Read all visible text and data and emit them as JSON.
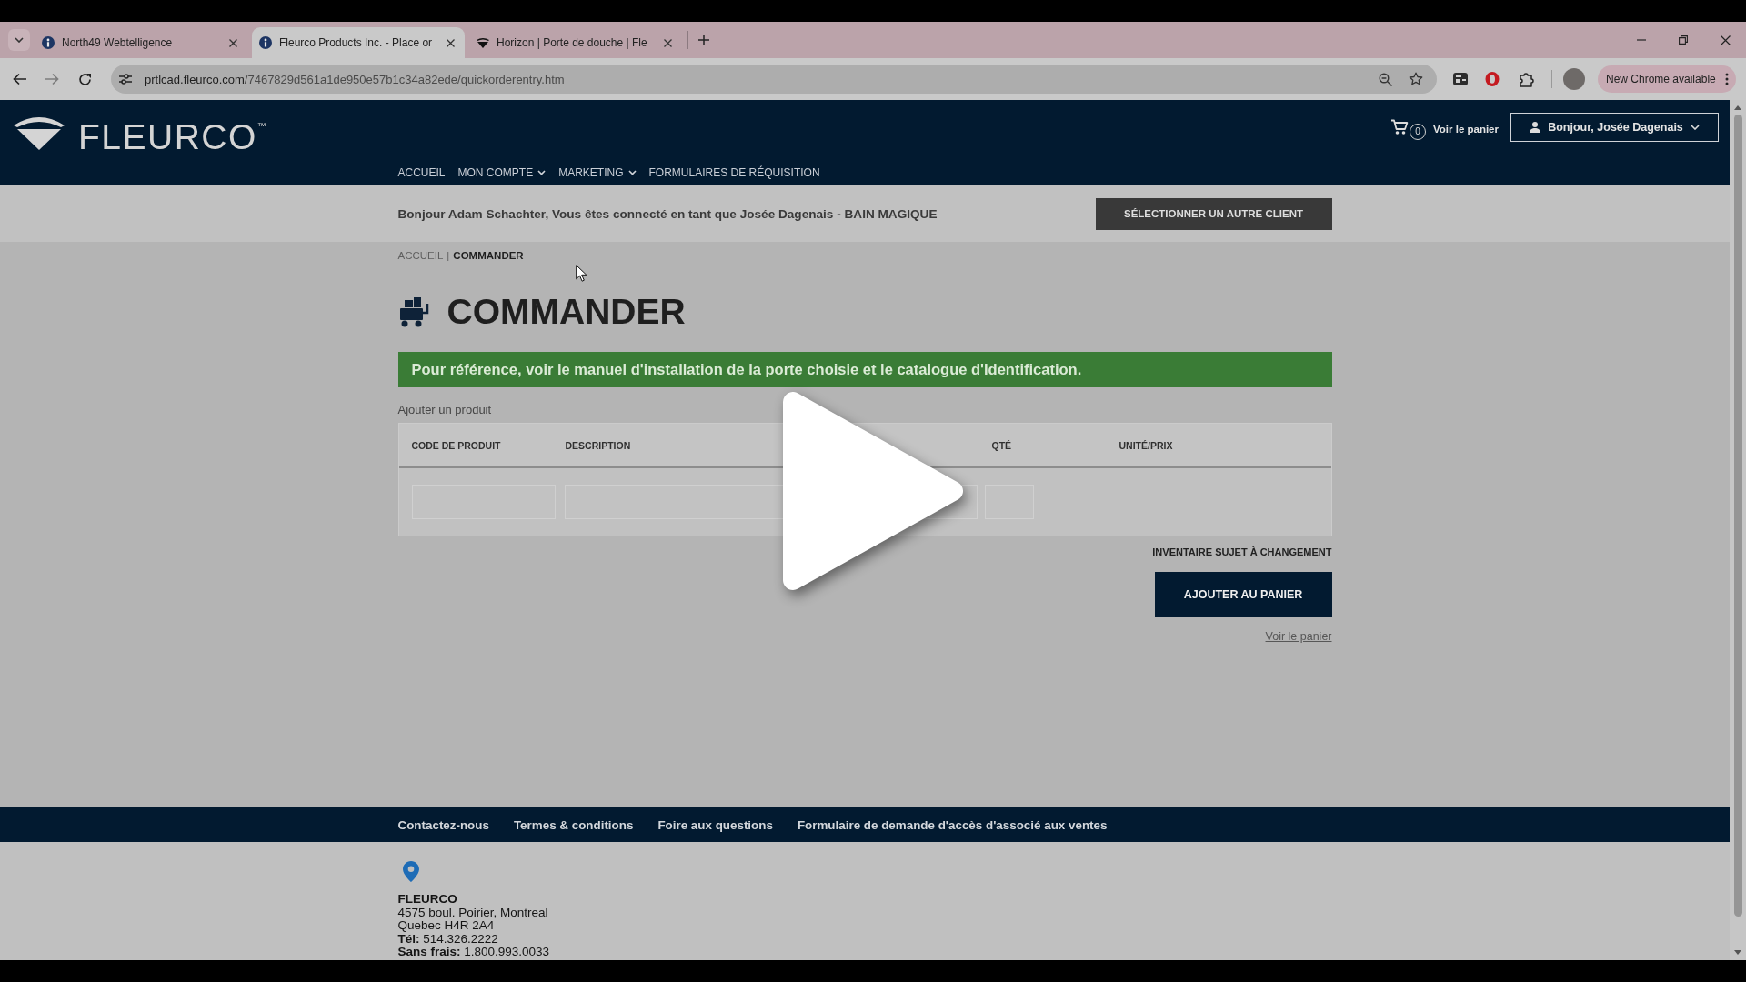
{
  "browser": {
    "tabs": [
      {
        "title": "North49 Webtelligence",
        "kind": "circle",
        "selected": false
      },
      {
        "title": "Fleurco Products Inc. - Place or",
        "kind": "circle",
        "selected": true
      },
      {
        "title": "Horizon | Porte de douche | Fle",
        "kind": "triangle",
        "selected": false
      }
    ],
    "forward_disabled": true,
    "url": {
      "host": "prtlcad.fleurco.com",
      "path": "/7467829d561a1de950e57b1c34a82ede/quickorderentry.htm"
    },
    "update_button": "New Chrome available"
  },
  "header": {
    "logo": "FLEURCO$^{™}$",
    "cart": {
      "count": "0",
      "label": "Voir le panier"
    },
    "user_menu": "Bonjour, Josée Dagenais",
    "nav": [
      {
        "label": "ACCUEIL",
        "dropdown": false
      },
      {
        "label": "MON COMPTE",
        "dropdown": true
      },
      {
        "label": "MARKETING",
        "dropdown": true
      },
      {
        "label": "FORMULAIRES DE RÉQUISITION",
        "dropdown": false
      }
    ]
  },
  "customer_bar": {
    "greeting": "Bonjour Adam Schachter, Vous êtes connecté en tant que Josée Dagenais - BAIN MAGIQUE",
    "button": "SÉLECTIONNER UN AUTRE CLIENT"
  },
  "breadcrumb": {
    "items": [
      {
        "label": "ACCUEIL",
        "current": false
      },
      {
        "label": "COMMANDER",
        "current": true
      }
    ],
    "separator": "|"
  },
  "page": {
    "title": "COMMANDER",
    "notice": "Pour référence, voir le manuel d'installation de la porte choisie et le catalogue d'Identification.",
    "form": {
      "label": "Ajouter un produit",
      "columns": [
        "CODE DE PRODUIT",
        "DESCRIPTION",
        "QTÉ",
        "UNITÉ/PRIX"
      ],
      "stock_note": "INVENTAIRE SUJET À CHANGEMENT",
      "add_button": "AJOUTER AU PANIER",
      "cart_link": "Voir le panier"
    }
  },
  "footer": {
    "links": [
      "Contactez-nous",
      "Termes & conditions",
      "Foire aux questions",
      "Formulaire de demande d'accès d'associé aux ventes"
    ],
    "company": "FLEURCO",
    "address": [
      "4575 boul. Poirier, Montreal",
      "Quebec H4R 2A4",
      "**Tél:** 514.326.2222",
      "**Sans frais:** 1.800.993.0033"
    ]
  },
  "video": {
    "paused": true
  }
}
